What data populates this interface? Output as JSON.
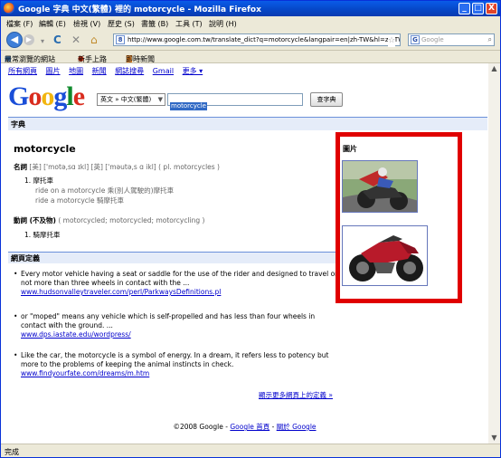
{
  "window": {
    "title": "Google 字典 中文(繁體) 裡的 motorcycle - Mozilla Firefox",
    "controls": [
      "_",
      "□",
      "X"
    ]
  },
  "menu": [
    "檔案 (F)",
    "編輯 (E)",
    "檢視 (V)",
    "歷史 (S)",
    "書籤 (B)",
    "工具 (T)",
    "說明 (H)"
  ],
  "nav": {
    "url": "http://www.google.com.tw/translate_dict?q=motorcycle&langpair=en|zh-TW&hl=zh-TW&sa",
    "url_icon": "8",
    "search_placeholder": "Google"
  },
  "bookmarks": [
    "最常瀏覽的網站",
    "新手上路",
    "即時新聞"
  ],
  "toplinks": [
    "所有網頁",
    "圖片",
    "地圖",
    "新聞",
    "網誌搜尋",
    "Gmail",
    "更多 ▾"
  ],
  "logo": [
    "G",
    "o",
    "o",
    "g",
    "l",
    "e"
  ],
  "search": {
    "lang": "英文 » 中文(繁體)",
    "query": "motorcycle",
    "button": "查字典"
  },
  "dict": {
    "section": "字典",
    "word": "motorcycle",
    "noun_pos": "名詞",
    "noun_pron": "[美] ['motə,sɑ ɪkl] [英] ['məutə,s ɑ ikl] ( pl. motorcycles )",
    "noun_defs": [
      {
        "num": "1.",
        "text": "摩托車",
        "examples": [
          "ride on a motorcycle 乘(別人駕駛的)摩托車",
          "ride a motorcycle 騎摩托車"
        ]
      }
    ],
    "verb_pos": "動詞 (不及物)",
    "verb_forms": "( motorcycled; motorcycled; motorcycling )",
    "verb_defs": [
      {
        "num": "1.",
        "text": "騎摩托車"
      }
    ]
  },
  "web": {
    "section": "網頁定義",
    "defs": [
      {
        "text": "Every motor vehicle having a seat or saddle for the use of the rider and designed to travel on not more than three wheels in contact with the ...",
        "url": "www.hudsonvalleytraveler.com/perl/ParkwaysDefinitions.pl"
      },
      {
        "text": "or \"moped\" means any vehicle which is self-propelled and has less than four wheels in contact with the ground. ...",
        "url": "www.dps.iastate.edu/wordpress/"
      },
      {
        "text": "Like the car, the motorcycle is a symbol of energy. In a dream, it refers less to potency but more to the problems of keeping the animal instincts in check.",
        "url": "www.findyourfate.com/dreams/m.htm"
      }
    ],
    "more": "顯示更多網頁上的定義 »"
  },
  "images": {
    "label": "圖片"
  },
  "footer": {
    "copyright": "©2008 Google - ",
    "home": "Google 首頁",
    "sep": " - ",
    "about": "關於 Google"
  },
  "status": "完成",
  "colors": {
    "highlight_box": "#e00000",
    "link": "#0000cc",
    "title_bar": "#0a5ce8"
  }
}
